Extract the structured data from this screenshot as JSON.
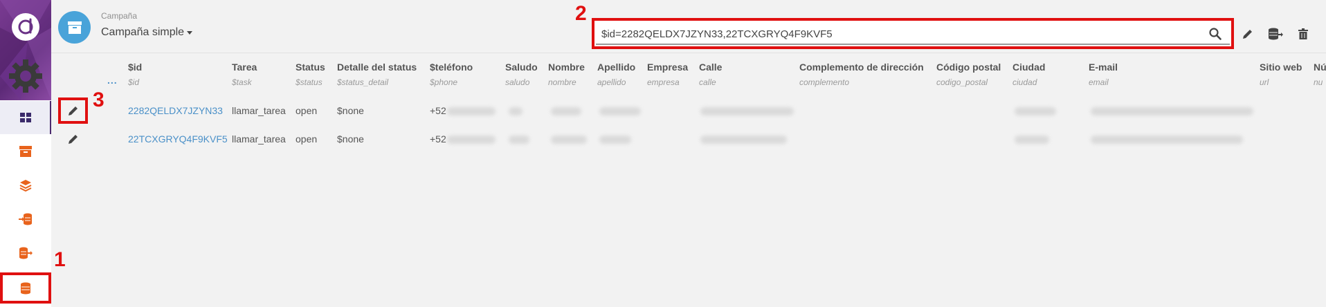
{
  "header": {
    "campaign_label": "Campaña",
    "campaign_name": "Campaña simple"
  },
  "search": {
    "value": "$id=2282QELDX7JZYN33,22TCXGRYQ4F9KVF5"
  },
  "annotations": [
    "1",
    "2",
    "3"
  ],
  "table": {
    "ellipsis": "...",
    "columns": [
      {
        "label": "$id",
        "sub": "$id"
      },
      {
        "label": "Tarea",
        "sub": "$task"
      },
      {
        "label": "Status",
        "sub": "$status"
      },
      {
        "label": "Detalle del status",
        "sub": "$status_detail"
      },
      {
        "label": "$teléfono",
        "sub": "$phone"
      },
      {
        "label": "Saludo",
        "sub": "saludo"
      },
      {
        "label": "Nombre",
        "sub": "nombre"
      },
      {
        "label": "Apellido",
        "sub": "apellido"
      },
      {
        "label": "Empresa",
        "sub": "empresa"
      },
      {
        "label": "Calle",
        "sub": "calle"
      },
      {
        "label": "Complemento de dirección",
        "sub": "complemento"
      },
      {
        "label": "Código postal",
        "sub": "codigo_postal"
      },
      {
        "label": "Ciudad",
        "sub": "ciudad"
      },
      {
        "label": "E-mail",
        "sub": "email"
      },
      {
        "label": "Sitio web",
        "sub": "url"
      },
      {
        "label": "Nú",
        "sub": "nu"
      }
    ],
    "rows": [
      {
        "id": "2282QELDX7JZYN33",
        "task": "llamar_tarea",
        "status": "open",
        "detail": "$none",
        "phone": "+52"
      },
      {
        "id": "22TCXGRYQ4F9KVF5",
        "task": "llamar_tarea",
        "status": "open",
        "detail": "$none",
        "phone": "+52"
      }
    ]
  },
  "colors": {
    "accent": "#49a3d9",
    "annotation": "#e01010",
    "sidebar_icon": "#e8631c",
    "sidebar_top": "#6a3286"
  },
  "icons": {
    "logo": "d-logo-icon",
    "gear": "gear-icon",
    "archive": "archive-icon",
    "search": "search-icon",
    "edit": "pencil-icon",
    "export": "database-export-icon",
    "delete": "trash-icon"
  }
}
